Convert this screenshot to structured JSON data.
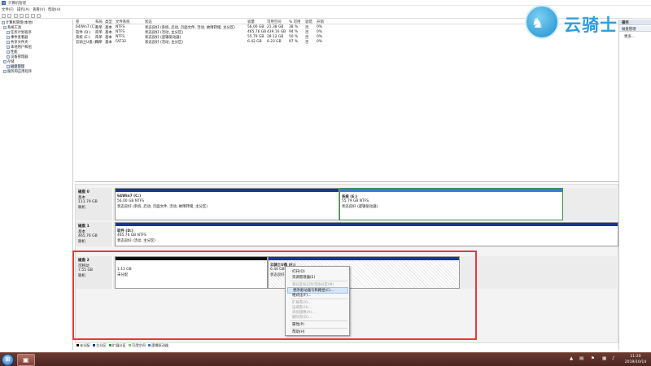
{
  "window": {
    "title": "计算机管理"
  },
  "menu": [
    "文件(F)",
    "操作(A)",
    "查看(V)",
    "帮助(H)"
  ],
  "tree": [
    {
      "label": "计算机管理(本地)",
      "depth": 0
    },
    {
      "label": "系统工具",
      "depth": 1
    },
    {
      "label": "任务计划程序",
      "depth": 2
    },
    {
      "label": "事件查看器",
      "depth": 2
    },
    {
      "label": "共享文件夹",
      "depth": 2
    },
    {
      "label": "本地用户和组",
      "depth": 2
    },
    {
      "label": "性能",
      "depth": 2
    },
    {
      "label": "设备管理器",
      "depth": 2
    },
    {
      "label": "存储",
      "depth": 1
    },
    {
      "label": "磁盘管理",
      "depth": 2
    },
    {
      "label": "服务和应用程序",
      "depth": 1
    }
  ],
  "volume_list": {
    "headers": [
      "卷",
      "布局",
      "类型",
      "文件系统",
      "状态",
      "容量",
      "可用空间",
      "% 可用",
      "容错",
      "开销"
    ],
    "rows": [
      [
        "64Win7 (C:)",
        "简单",
        "基本",
        "NTFS",
        "状态良好 (系统, 启动, 页面文件, 活动, 故障转储, 主分区)",
        "56.00 GB",
        "21.38 GB",
        "38 %",
        "否",
        "0%"
      ],
      [
        "软件 (D:)",
        "简单",
        "基本",
        "NTFS",
        "状态良好 (活动, 主分区)",
        "465.76 GB",
        "439.16 GB",
        "94 %",
        "否",
        "0%"
      ],
      [
        "系统 (E:)",
        "简单",
        "基本",
        "NTFS",
        "状态良好 (逻辑驱动器)",
        "55.79 GB",
        "28.12 GB",
        "50 %",
        "否",
        "0%"
      ],
      [
        "云骑士U盘 (F:)",
        "简单",
        "基本",
        "FAT32",
        "状态良好 (活动, 主分区)",
        "6.42 GB",
        "6.23 GB",
        "97 %",
        "否",
        "0%"
      ]
    ]
  },
  "disks": [
    {
      "name": "磁盘 0",
      "type": "基本",
      "size": "111.79 GB",
      "status": "联机",
      "partitions": [
        {
          "title": "64Win7 (C:)",
          "line1": "56.00 GB NTFS",
          "line2": "状态良好 (系统, 启动, 页面文件, 活动, 故障转储, 主分区)"
        },
        {
          "title": "系统 (E:)",
          "line1": "55.79 GB NTFS",
          "line2": "状态良好 (逻辑驱动器)"
        }
      ]
    },
    {
      "name": "磁盘 1",
      "type": "基本",
      "size": "465.76 GB",
      "status": "联机",
      "partitions": [
        {
          "title": "软件 (D:)",
          "line1": "465.76 GB NTFS",
          "line2": "状态良好 (活动, 主分区)"
        }
      ]
    },
    {
      "name": "磁盘 2",
      "type": "可移动",
      "size": "7.55 GB",
      "status": "联机",
      "partitions": [
        {
          "title": "",
          "line1": "1.13 GB",
          "line2": "未分配"
        },
        {
          "title": "云骑士U盘 (F:)",
          "line1": "6.44 GB",
          "line2": "状态良好"
        }
      ]
    }
  ],
  "legend": [
    "未分配",
    "主分区",
    "扩展分区",
    "可用空间",
    "逻辑驱动器"
  ],
  "actions": {
    "header": "操作",
    "sub": "磁盘管理",
    "more": "更多..."
  },
  "context_menu": [
    {
      "label": "打开(O)",
      "state": "normal"
    },
    {
      "label": "资源管理器(E)",
      "state": "normal"
    },
    {
      "label": "将分区标记为活动分区(M)",
      "state": "disabled"
    },
    {
      "label": "更改驱动器号和路径(C)...",
      "state": "highlight"
    },
    {
      "label": "格式化(F)...",
      "state": "normal"
    },
    {
      "label": "扩展卷(X)...",
      "state": "disabled"
    },
    {
      "label": "压缩卷(H)...",
      "state": "disabled"
    },
    {
      "label": "添加镜像(A)...",
      "state": "disabled"
    },
    {
      "label": "删除卷(D)...",
      "state": "disabled"
    },
    {
      "label": "属性(P)",
      "state": "normal"
    },
    {
      "label": "帮助(H)",
      "state": "normal"
    }
  ],
  "watermark": {
    "brand": "云骑士"
  },
  "taskbar": {
    "time": "11:20",
    "date": "2019/10/14"
  }
}
